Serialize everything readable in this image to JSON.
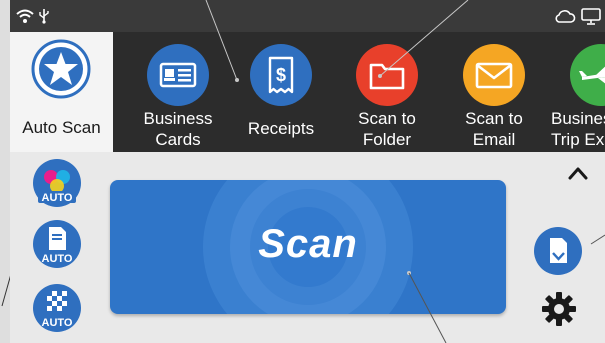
{
  "auto_scan": {
    "label": "Auto Scan",
    "icon": "star-icon"
  },
  "apps": [
    {
      "label": "Business\nCards",
      "icon": "business-card-icon",
      "color": "#2f6fbf"
    },
    {
      "label": "Receipts",
      "icon": "receipt-icon",
      "color": "#2f6fbf"
    },
    {
      "label": "Scan to\nFolder",
      "icon": "folder-icon",
      "color": "#e8402b"
    },
    {
      "label": "Scan to\nEmail",
      "icon": "envelope-icon",
      "color": "#f5a623"
    },
    {
      "label": "Business\nTrip Expenses",
      "icon": "airplane-icon",
      "color": "#3fae49"
    }
  ],
  "mode_buttons": [
    {
      "label": "AUTO",
      "icon": "color-mode-auto-icon"
    },
    {
      "label": "AUTO",
      "icon": "page-side-auto-icon"
    },
    {
      "label": "AUTO",
      "icon": "resolution-auto-icon"
    }
  ],
  "scan_button": {
    "label": "Scan"
  },
  "colors": {
    "accent": "#2f75c8",
    "dark_bar": "#2c2c2c",
    "tile_light": "#f4f4f4"
  }
}
